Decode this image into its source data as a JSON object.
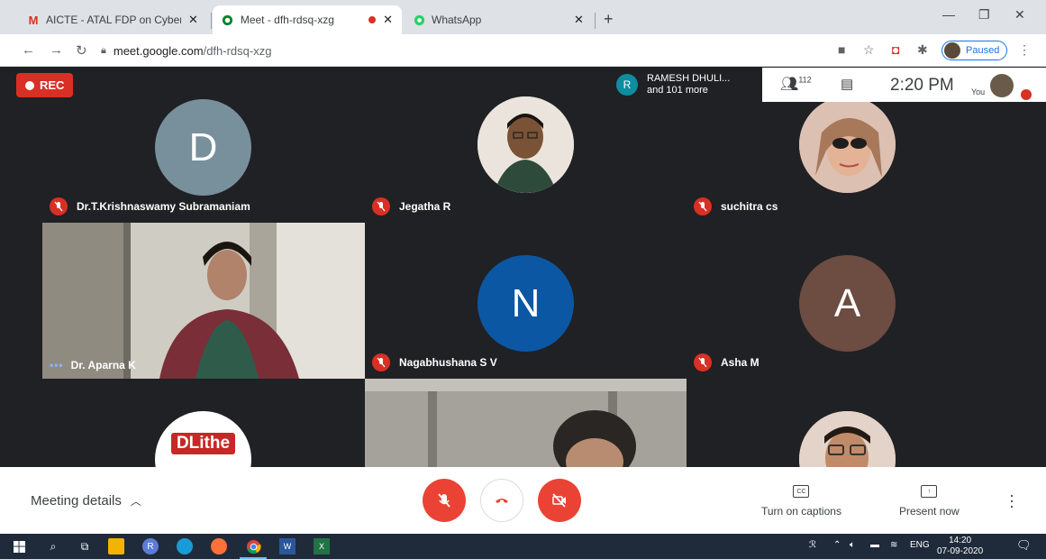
{
  "browser": {
    "tabs": [
      {
        "title": "AICTE - ATAL FDP on Cyber Secur",
        "favicon": "gmail-icon",
        "active": false
      },
      {
        "title": "Meet - dfh-rdsq-xzg",
        "favicon": "meet-icon",
        "active": true
      },
      {
        "title": "WhatsApp",
        "favicon": "whatsapp-icon",
        "active": false
      }
    ],
    "url_host": "meet.google.com",
    "url_path": "/dfh-rdsq-xzg",
    "profile_status": "Paused"
  },
  "meet": {
    "recording_label": "REC",
    "presenter": {
      "initial": "R",
      "name": "RAMESH DHULI...",
      "subtitle": "and 101 more"
    },
    "participant_count": "112",
    "time": "2:20 PM",
    "self_label": "You",
    "tiles": [
      {
        "name": "Dr.T.Krishnaswamy Subramaniam",
        "initial": "D",
        "color": "#78909c",
        "muted": true
      },
      {
        "name": "Jegatha R",
        "muted": true
      },
      {
        "name": "suchitra cs",
        "muted": true
      },
      {
        "name": "Dr. Aparna K",
        "muted": false,
        "speaking": true
      },
      {
        "name": "Nagabhushana S V",
        "initial": "N",
        "color": "#0b57a4",
        "muted": true
      },
      {
        "name": "Asha M",
        "initial": "A",
        "color": "#6d4c41",
        "muted": true
      },
      {
        "name": "",
        "logo_text": "DLithe"
      },
      {
        "name": ""
      },
      {
        "name": ""
      }
    ]
  },
  "controls": {
    "meeting_details": "Meeting details",
    "captions_label": "Turn on captions",
    "captions_icon_text": "CC",
    "present_label": "Present now"
  },
  "taskbar": {
    "language": "ENG",
    "time": "14:20",
    "date": "07-09-2020"
  },
  "colors": {
    "meet_bg": "#202124",
    "red": "#ea4335",
    "accent_blue": "#1a73e8"
  }
}
